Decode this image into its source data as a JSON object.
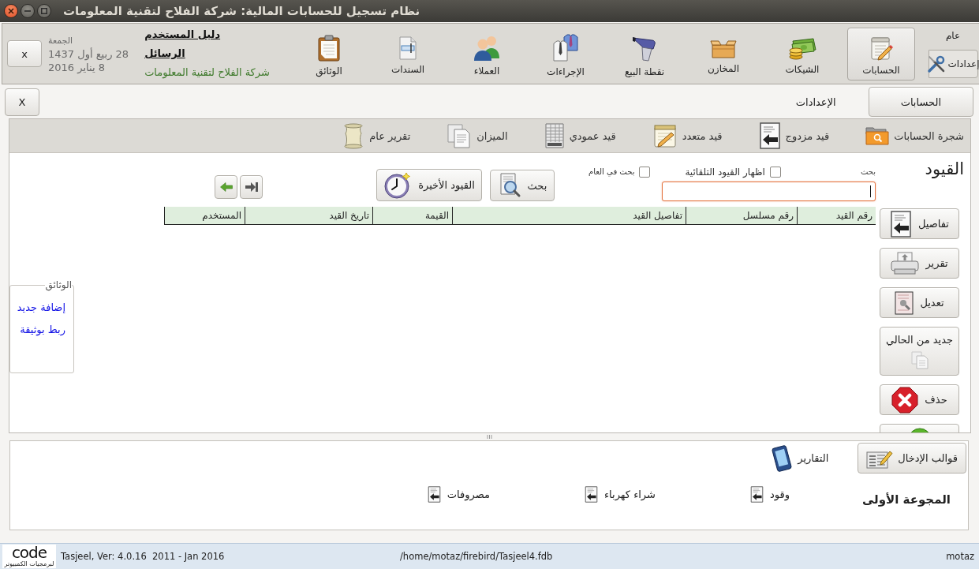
{
  "window": {
    "title": "نظام تسجيل للحسابات المالية: شركة الفلاح لتقنية المعلومات"
  },
  "side_tabs": [
    {
      "label": "عام",
      "selected": true
    },
    {
      "label": "إعدادات",
      "selected": false
    }
  ],
  "toolbar": {
    "items": [
      {
        "label": "الحسابات",
        "selected": true
      },
      {
        "label": "الشيكات",
        "selected": false
      },
      {
        "label": "المخازن",
        "selected": false
      },
      {
        "label": "نقطة البيع",
        "selected": false
      },
      {
        "label": "الإجراءات",
        "selected": false
      },
      {
        "label": "العملاء",
        "selected": false
      },
      {
        "label": "السندات",
        "selected": false
      },
      {
        "label": "الوثائق",
        "selected": false
      }
    ]
  },
  "header": {
    "links": [
      "دليل المستخدم",
      "الرسائل"
    ],
    "company": "شركة الفلاح لتقنية المعلومات",
    "date": {
      "weekday": "الجمعة",
      "hijri": "28 ربيع أول 1437",
      "gregorian": "8 يناير 2016"
    },
    "close_button": "x"
  },
  "module_tabs": [
    {
      "label": "الحسابات",
      "selected": true
    },
    {
      "label": "الإعدادات",
      "selected": false
    }
  ],
  "module_close_button": "X",
  "sub_toolbar": [
    "شجرة الحسابات",
    "قيد مزدوج",
    "قيد متعدد",
    "قيد عمودي",
    "الميزان",
    "تقرير عام"
  ],
  "entries": {
    "title": "القيود",
    "search_label": "بحث",
    "options": [
      {
        "label": "اظهار القيود التلقائية",
        "checked": false
      },
      {
        "label": "بحث في العام",
        "checked": false
      }
    ],
    "search_button": "بحث",
    "recent_button": "القيود الأخيرة"
  },
  "table": {
    "columns": [
      "رقم القيد",
      "رقم مسلسل",
      "تفاصيل القيد",
      "القيمة",
      "تاريخ القيد",
      "المستخدم"
    ]
  },
  "actions": [
    {
      "label": "تفاصيل",
      "kind": "inline"
    },
    {
      "label": "تقرير",
      "kind": "inline"
    },
    {
      "label": "تعديل",
      "kind": "inline"
    },
    {
      "label": "جديد من الحالي",
      "kind": "stacked"
    },
    {
      "label": "حذف",
      "kind": "inline"
    }
  ],
  "documents": {
    "title": "الوثائق",
    "links": [
      "إضافة جديد",
      "ربط بوثيقة"
    ]
  },
  "bottom_tabs": [
    {
      "label": "قوالب الإدخال",
      "selected": true
    },
    {
      "label": "التقارير",
      "selected": false
    }
  ],
  "templates": {
    "group": "المجوعة الأولى",
    "items": [
      "وقود",
      "شراء كهرباء",
      "مصروفات"
    ]
  },
  "status_bar": {
    "logo": "code",
    "logo_caption": "لبرمجيات الكمبيوتر",
    "version": "Tasjeel, Ver: 4.0.16  2011 - Jan 2016",
    "database": "/home/motaz/firebird/Tasjeel4.fdb",
    "user": "motaz"
  }
}
